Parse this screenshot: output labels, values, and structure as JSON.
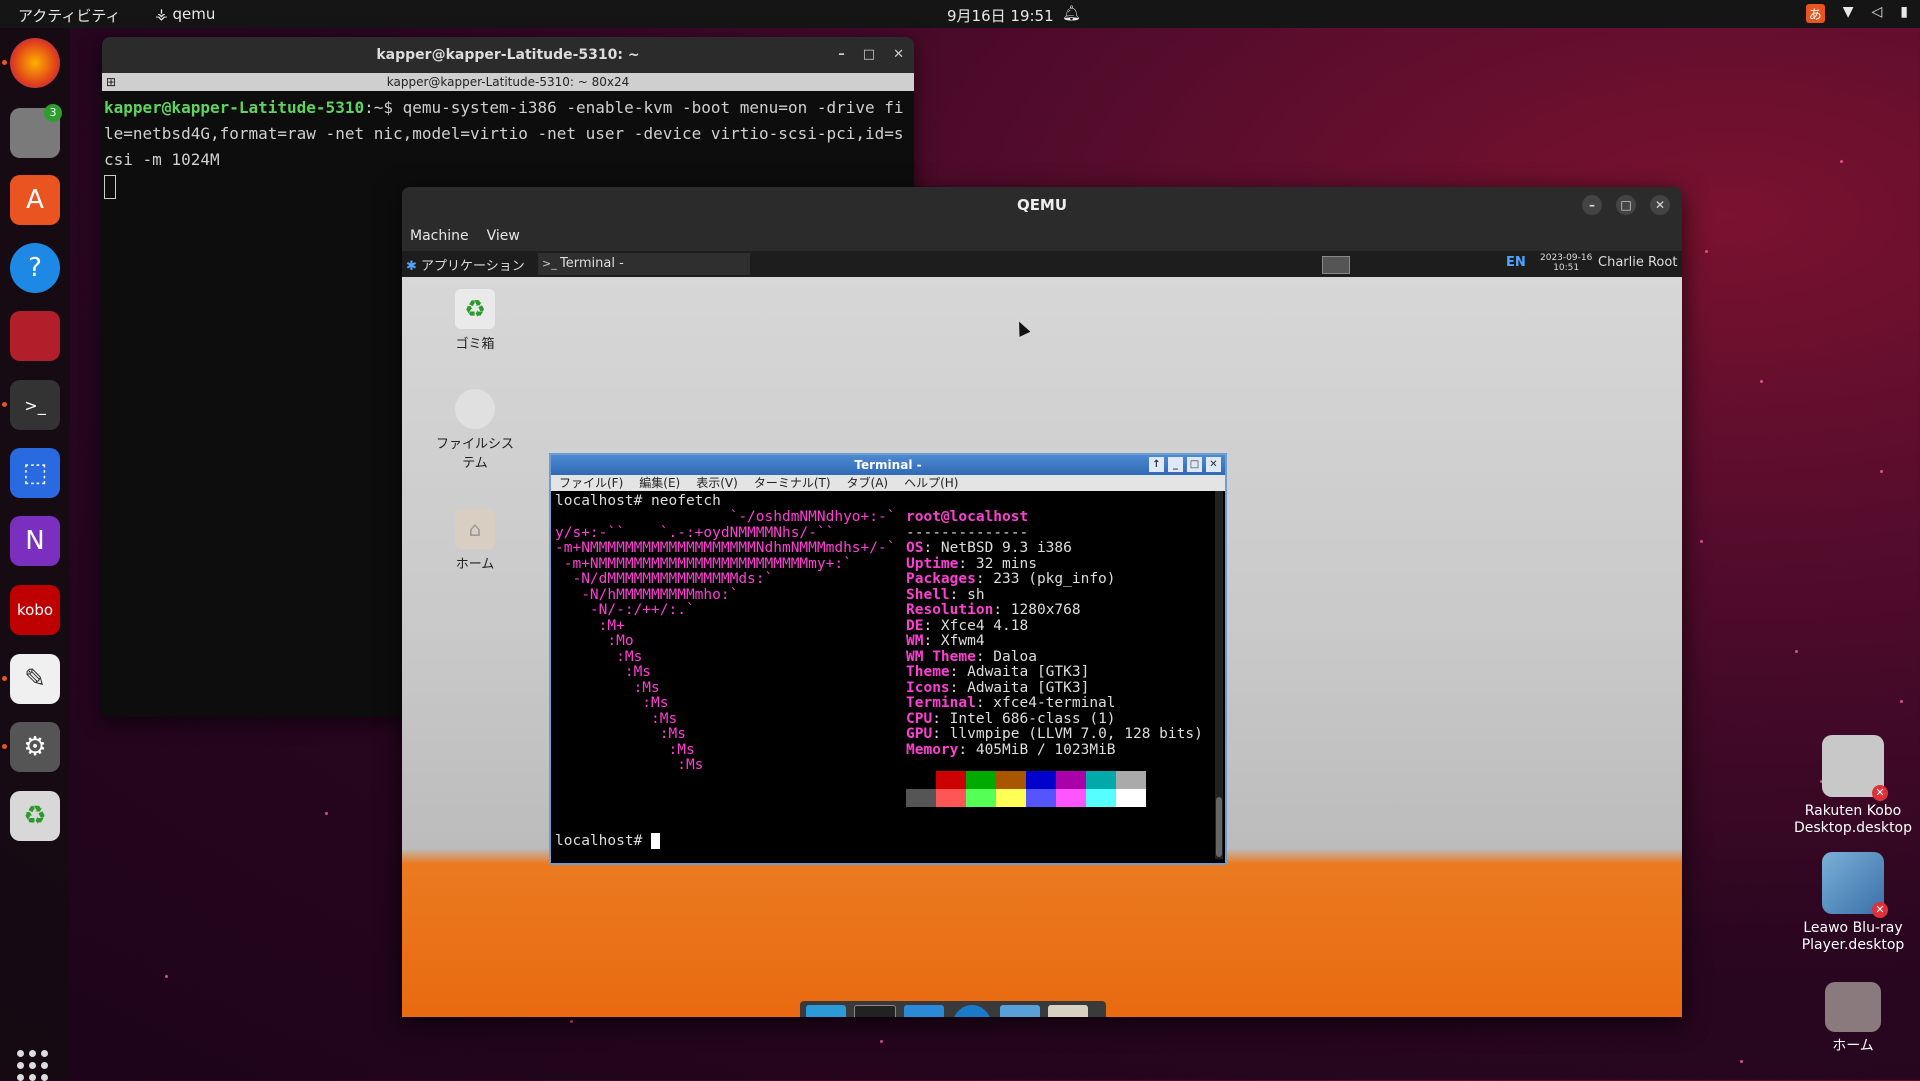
{
  "topbar": {
    "activities": "アクティビティ",
    "app_name": "qemu",
    "clock": "9月16日  19:51",
    "ime": "あ"
  },
  "dock": {
    "files_badge": "3",
    "onenote": "N",
    "kobo": "kobo"
  },
  "host_terminal": {
    "title": "kapper@kapper-Latitude-5310: ~",
    "subtitle": "kapper@kapper-Latitude-5310: ~ 80x24",
    "prompt": "kapper@kapper-Latitude-5310",
    "prompt_suffix": ":~$ ",
    "command": "qemu-system-i386 -enable-kvm -boot menu=on -drive file=netbsd4G,format=raw -net nic,model=virtio -net user -device virtio-scsi-pci,id=scsi -m 1024M"
  },
  "qemu": {
    "title": "QEMU",
    "menu": [
      "Machine",
      "View"
    ]
  },
  "guest_panel": {
    "apps": "アプリケーション",
    "task": "Terminal -",
    "lang": "EN",
    "date": "2023-09-16",
    "time": "10:51",
    "user": "Charlie Root"
  },
  "guest_desktop": {
    "trash": "ゴミ箱",
    "filesystem": "ファイルシステム",
    "home": "ホーム"
  },
  "xterm": {
    "title": "Terminal -",
    "menu": [
      "ファイル(F)",
      "編集(E)",
      "表示(V)",
      "ターミナル(T)",
      "タブ(A)",
      "ヘルプ(H)"
    ],
    "cmd_line": "localhost# neofetch",
    "final_prompt": "localhost# ",
    "logo": [
      "                    `-/oshdmNMNdhyo+:-`",
      "y/s+:-``    `.-:+oydNMMMMNhs/-``",
      "-m+NMMMMMMMMMMMMMMMMMMMNdhmNMMMmdhs+/-`",
      " -m+NMMMMMMMMMMMMMMMMMMMMMMMMmy+:`",
      "  -N/dMMMMMMMMMMMMMMMds:`",
      "   -N/hMMMMMMMMMmho:`",
      "    -N/-:/++/:.`",
      "     :M+",
      "      :Mo",
      "       :Ms",
      "        :Ms",
      "         :Ms",
      "          :Ms",
      "           :Ms",
      "            :Ms",
      "             :Ms",
      "              :Ms"
    ],
    "user_host": "root@localhost",
    "separator": "--------------",
    "info": [
      {
        "k": "OS",
        "v": "NetBSD 9.3 i386"
      },
      {
        "k": "Uptime",
        "v": "32 mins"
      },
      {
        "k": "Packages",
        "v": "233 (pkg_info)"
      },
      {
        "k": "Shell",
        "v": "sh"
      },
      {
        "k": "Resolution",
        "v": "1280x768"
      },
      {
        "k": "DE",
        "v": "Xfce4 4.18"
      },
      {
        "k": "WM",
        "v": "Xfwm4"
      },
      {
        "k": "WM Theme",
        "v": "Daloa"
      },
      {
        "k": "Theme",
        "v": "Adwaita [GTK3]"
      },
      {
        "k": "Icons",
        "v": "Adwaita [GTK3]"
      },
      {
        "k": "Terminal",
        "v": "xfce4-terminal"
      },
      {
        "k": "CPU",
        "v": "Intel 686-class (1)"
      },
      {
        "k": "GPU",
        "v": "llvmpipe (LLVM 7.0, 128 bits)"
      },
      {
        "k": "Memory",
        "v": "405MiB / 1023MiB"
      }
    ],
    "palette_top": [
      "#000000",
      "#cc0000",
      "#00aa00",
      "#aa5500",
      "#0000cc",
      "#aa00aa",
      "#00aaaa",
      "#aaaaaa"
    ],
    "palette_bottom": [
      "#555555",
      "#ff5555",
      "#55ff55",
      "#ffff55",
      "#5555ff",
      "#ff55ff",
      "#55ffff",
      "#ffffff"
    ]
  },
  "desktop": {
    "kobo_label": "Rakuten Kobo Desktop.desktop",
    "leawo_label": "Leawo Blu-ray Player.desktop",
    "home_label": "ホーム"
  },
  "colors": {
    "ubuntu_orange": "#e95420",
    "neofetch_magenta": "#ff3fd4"
  }
}
